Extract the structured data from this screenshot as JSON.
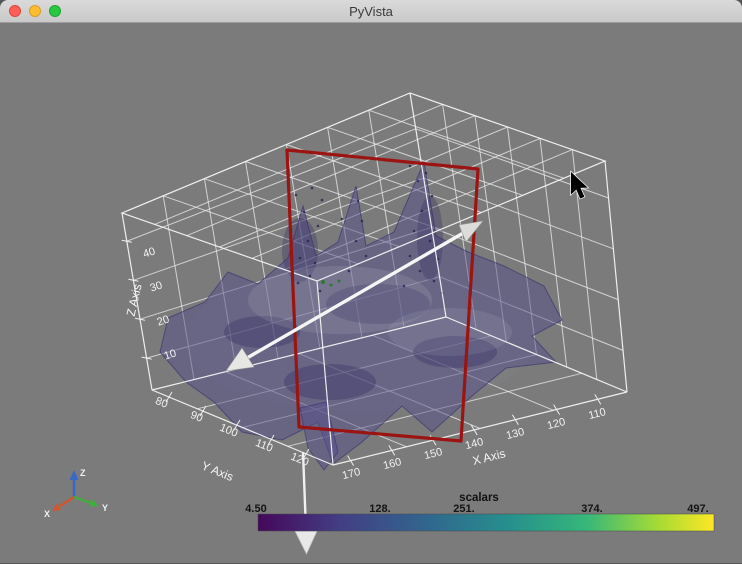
{
  "window": {
    "title": "PyVista"
  },
  "scene": {
    "mesh_color": "#55508b",
    "widgets": {
      "plane_color": "#9c1412",
      "arrow_color": "#f5f5f5"
    },
    "axes": {
      "x": {
        "label": "X Axis",
        "ticks": [
          "170",
          "160",
          "150",
          "140",
          "130",
          "120",
          "110"
        ]
      },
      "y": {
        "label": "Y Axis",
        "ticks": [
          "80",
          "90",
          "100",
          "110",
          "120"
        ]
      },
      "z": {
        "label": "Z Axis",
        "ticks": [
          "10",
          "20",
          "30",
          "40"
        ]
      }
    },
    "orientation_widget": {
      "x_label": "X",
      "y_label": "Y",
      "z_label": "Z",
      "x_color": "#d4542c",
      "y_color": "#3fae3f",
      "z_color": "#3a68c8"
    },
    "scalar_bar": {
      "title": "scalars",
      "tick_labels": [
        "4.50",
        "128.",
        "251.",
        "374.",
        "497."
      ],
      "colormap": [
        "#45075a",
        "#433e85",
        "#30688e",
        "#26908d",
        "#36b779",
        "#a8db34",
        "#fde725"
      ]
    }
  }
}
